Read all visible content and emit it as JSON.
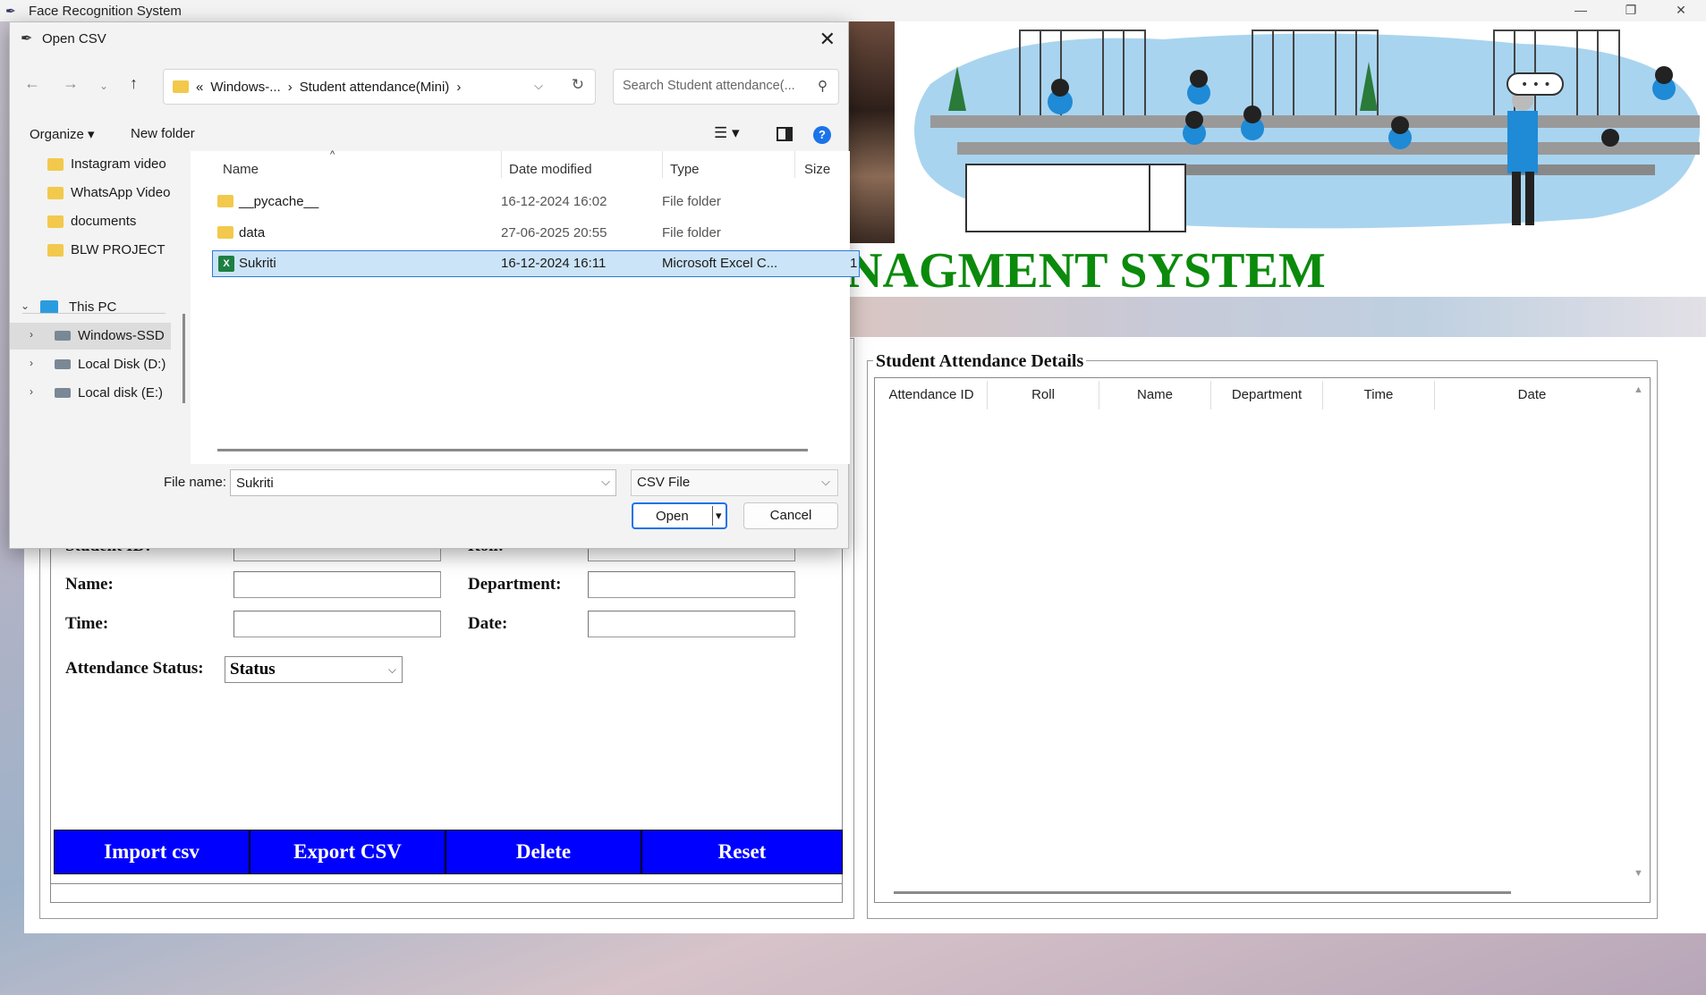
{
  "window": {
    "title": "Face Recognition System",
    "controls": [
      "—",
      "❐",
      "✕"
    ]
  },
  "banner": {
    "title": "NAGMENT   SYSTEM"
  },
  "form": {
    "student_id_label": "Student ID:",
    "roll_label": "Roll:",
    "name_label": "Name:",
    "department_label": "Department:",
    "time_label": "Time:",
    "date_label": "Date:",
    "status_label": "Attendance Status:",
    "status_value": "Status"
  },
  "buttons": {
    "import": "Import csv",
    "export": "Export CSV",
    "delete": "Delete",
    "reset": "Reset"
  },
  "details": {
    "legend": "Student  Attendance Details",
    "columns": [
      "Attendance ID",
      "Roll",
      "Name",
      "Department",
      "Time",
      "Date"
    ]
  },
  "dialog": {
    "title": "Open CSV",
    "breadcrumb": [
      "«",
      "Windows-...",
      "›",
      "Student attendance(Mini)",
      "›"
    ],
    "search_placeholder": "Search Student attendance(...",
    "organize": "Organize ▾",
    "new_folder": "New folder",
    "help": "?",
    "nav_items": [
      {
        "label": "Instagram video",
        "icon": "folder-icon"
      },
      {
        "label": "WhatsApp Video",
        "icon": "folder-icon"
      },
      {
        "label": "documents",
        "icon": "folder-icon"
      },
      {
        "label": "BLW PROJECT",
        "icon": "folder-icon"
      },
      {
        "label": "This PC",
        "icon": "pc-icon"
      },
      {
        "label": "Windows-SSD",
        "icon": "drive-icon"
      },
      {
        "label": "Local Disk (D:)",
        "icon": "drive-icon"
      },
      {
        "label": "Local disk (E:)",
        "icon": "drive-icon"
      }
    ],
    "columns": {
      "name": "Name",
      "date": "Date modified",
      "type": "Type",
      "size": "Size"
    },
    "files": [
      {
        "name": "__pycache__",
        "date": "16-12-2024 16:02",
        "type": "File folder",
        "size": ""
      },
      {
        "name": "data",
        "date": "27-06-2025 20:55",
        "type": "File folder",
        "size": ""
      },
      {
        "name": "Sukriti",
        "date": "16-12-2024 16:11",
        "type": "Microsoft Excel C...",
        "size": "1"
      }
    ],
    "file_name_label": "File name:",
    "file_name_value": "Sukriti",
    "file_type": "CSV File",
    "open": "Open",
    "cancel": "Cancel"
  },
  "colors": {
    "button_blue": "#0000ff",
    "banner_green": "#0b8a0b",
    "selection": "#cce4f7"
  }
}
